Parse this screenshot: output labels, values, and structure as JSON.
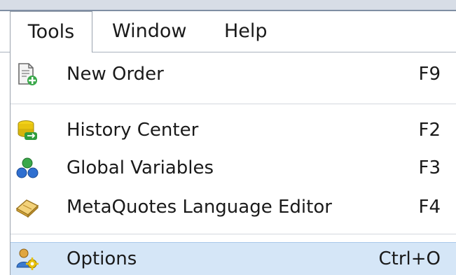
{
  "menubar": {
    "tabs": [
      {
        "label": "Tools",
        "active": true
      },
      {
        "label": "Window",
        "active": false
      },
      {
        "label": "Help",
        "active": false
      }
    ]
  },
  "menu": {
    "items": [
      {
        "label": "New Order",
        "shortcut": "F9",
        "icon": "new-order-icon"
      },
      {
        "label": "History Center",
        "shortcut": "F2",
        "icon": "history-center-icon"
      },
      {
        "label": "Global Variables",
        "shortcut": "F3",
        "icon": "global-variables-icon"
      },
      {
        "label": "MetaQuotes Language Editor",
        "shortcut": "F4",
        "icon": "metaeditor-icon"
      },
      {
        "label": "Options",
        "shortcut": "Ctrl+O",
        "icon": "options-icon",
        "highlighted": true
      }
    ]
  },
  "colors": {
    "highlight": "#d5e6f7",
    "menu_border": "#9aa3ae"
  }
}
